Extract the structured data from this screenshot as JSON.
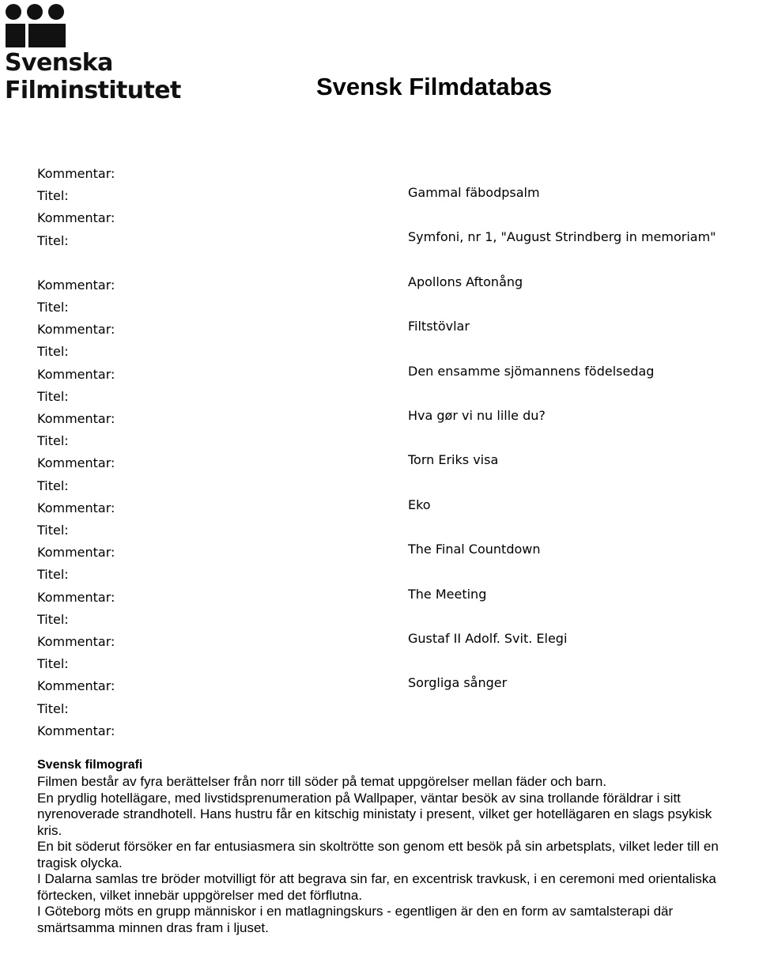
{
  "header": {
    "logo": {
      "icon": "svenska-filminstitutet-logo",
      "wordmark_line1": "Svenska",
      "wordmark_line2": "Filminstitutet"
    },
    "title": "Svensk Filmdatabas"
  },
  "credits": {
    "label_comment": "Kommentar:",
    "label_title": "Titel:",
    "rows": [
      {
        "comment": "Kommentar:",
        "label": "Titel:",
        "title": "Gammal fäbodpsalm"
      },
      {
        "comment": "Kommentar:",
        "label": "Titel:",
        "title": "Symfoni, nr 1, \"August Strindberg in memoriam\""
      },
      {
        "comment": "Kommentar:",
        "label": "Titel:",
        "title": "Apollons Aftonång"
      },
      {
        "comment": "Kommentar:",
        "label": "Titel:",
        "title": "Filtstövlar"
      },
      {
        "comment": "Kommentar:",
        "label": "Titel:",
        "title": "Den ensamme sjömannens födelsedag"
      },
      {
        "comment": "Kommentar:",
        "label": "Titel:",
        "title": "Hva gør vi nu lille du?"
      },
      {
        "comment": "Kommentar:",
        "label": "Titel:",
        "title": "Torn Eriks visa"
      },
      {
        "comment": "Kommentar:",
        "label": "Titel:",
        "title": "Eko"
      },
      {
        "comment": "Kommentar:",
        "label": "Titel:",
        "title": "The Final Countdown"
      },
      {
        "comment": "Kommentar:",
        "label": "Titel:",
        "title": "The Meeting"
      },
      {
        "comment": "Kommentar:",
        "label": "Titel:",
        "title": "Gustaf II Adolf. Svit. Elegi"
      },
      {
        "comment": "Kommentar:",
        "label": "Titel:",
        "title": "Sorgliga sånger"
      }
    ],
    "trailing_comment": "Kommentar:"
  },
  "filmography": {
    "heading": "Svensk filmografi",
    "paragraphs": [
      "Filmen består av fyra berättelser från norr till söder på temat uppgörelser mellan fäder och barn.",
      "En prydlig hotellägare, med livstidsprenumeration på Wallpaper, väntar besök av sina trollande föräldrar i sitt nyrenoverade strandhotell. Hans hustru får en kitschig ministaty i present, vilket ger hotellägaren en slags psykisk kris.",
      "En bit söderut försöker en far entusiasmera sin skoltrötte son genom ett besök på sin arbetsplats, vilket leder till en tragisk olycka.",
      "I Dalarna samlas tre bröder motvilligt för att begrava sin far, en excentrisk travkusk, i en ceremoni med orientaliska förtecken, vilket innebär uppgörelser med det förflutna.",
      "I Göteborg möts en grupp människor i en matlagningskurs - egentligen är den en form av samtalsterapi där smärtsamma minnen dras fram i ljuset."
    ]
  }
}
